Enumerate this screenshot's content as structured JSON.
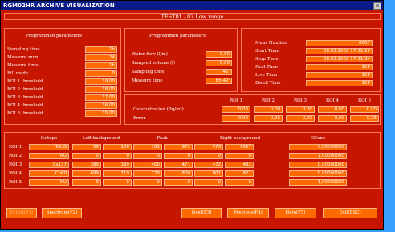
{
  "window": {
    "title": "RGM02HR ARCHIVE VISUALIZATION",
    "close": "×"
  },
  "header": {
    "text": "TEST01   -   07   Low range"
  },
  "prog1": {
    "title": "Programmed parameters",
    "rows": [
      {
        "label": "Sampling time",
        "value": "1h"
      },
      {
        "label": "Measure num",
        "value": "24"
      },
      {
        "label": "Measure time",
        "value": "1h"
      },
      {
        "label": "Fill mode",
        "value": "0"
      },
      {
        "label": "ROI 1 threshold",
        "value": "19,00"
      },
      {
        "label": "ROI 2 threshold",
        "value": "18,00"
      },
      {
        "label": "ROI 3 threshold",
        "value": "17,00"
      },
      {
        "label": "ROI 4 threshold",
        "value": "16,00"
      },
      {
        "label": "ROI 5 threshold",
        "value": "15,00"
      }
    ]
  },
  "prog2": {
    "title": "Programmed parameters",
    "rows": [
      {
        "label": "Water flow (l/m)",
        "value": "0,00"
      },
      {
        "label": "Sampled volume (l)",
        "value": "0,00"
      },
      {
        "label": "Sampling time",
        "value": "42'"
      },
      {
        "label": "Measure time",
        "value": "6h 42'"
      }
    ]
  },
  "meas": {
    "rows": [
      {
        "label": "Meas Number",
        "value": "0007"
      },
      {
        "label": "Start Time",
        "value": "08.03.2002 17:31:29"
      },
      {
        "label": "Stop Time",
        "value": "08.03.2002 17:31:34"
      },
      {
        "label": "Real Time",
        "value": "120"
      },
      {
        "label": "Live Time",
        "value": "120"
      },
      {
        "label": "Dwell Time",
        "value": "120"
      }
    ]
  },
  "conc": {
    "headers": [
      "ROI 1",
      "ROI 2",
      "ROI 3",
      "ROI 4",
      "ROI 5"
    ],
    "conc_label": "Concentration (Bq/m³)",
    "conc_values": [
      "0,00",
      "0,00",
      "0,00",
      "0,00",
      "0,00"
    ],
    "error_label": "Error",
    "error_values": [
      "0,00",
      "0,26",
      "0,00",
      "0,00",
      "0,26"
    ]
  },
  "table": {
    "headers": {
      "isotope": "Isotope",
      "left": "Left background",
      "peak": "Peak",
      "right": "Right background",
      "kconc": "KConc"
    },
    "rows": [
      {
        "roi": "ROI 1",
        "iso": "Tot.G",
        "l1": "50",
        "l2": "100",
        "p1": "101",
        "p2": "972",
        "r1": "973",
        "r2": "1027",
        "k": "0,00000000"
      },
      {
        "roi": "ROI 2",
        "iso": "NU",
        "l1": "0",
        "l2": "0",
        "p1": "0",
        "p2": "0",
        "r1": "0",
        "r2": "0",
        "k": "1,00000000"
      },
      {
        "roi": "ROI 3",
        "iso": "Cs137",
        "l1": "389",
        "l2": "399",
        "p1": "400",
        "p2": "471",
        "r1": "472",
        "r2": "482",
        "k": "0,00000000"
      },
      {
        "roi": "ROI 4",
        "iso": "Co60",
        "l1": "699",
        "l2": "719",
        "p1": "720",
        "p2": "800",
        "r1": "801",
        "r2": "821",
        "k": "0,00000000"
      },
      {
        "roi": "ROI 5",
        "iso": "NU",
        "l1": "0",
        "l2": "0",
        "p1": "0",
        "p2": "0",
        "r1": "0",
        "r2": "0",
        "k": "1,00000000"
      }
    ]
  },
  "buttons": {
    "pclist": "PcList(F1)",
    "spectrum": "Spectrum(F2)",
    "next": "Next(F3)",
    "previous": "Previous(F4)",
    "help": "Help(F5)",
    "exit": "Exit(ESC)"
  }
}
